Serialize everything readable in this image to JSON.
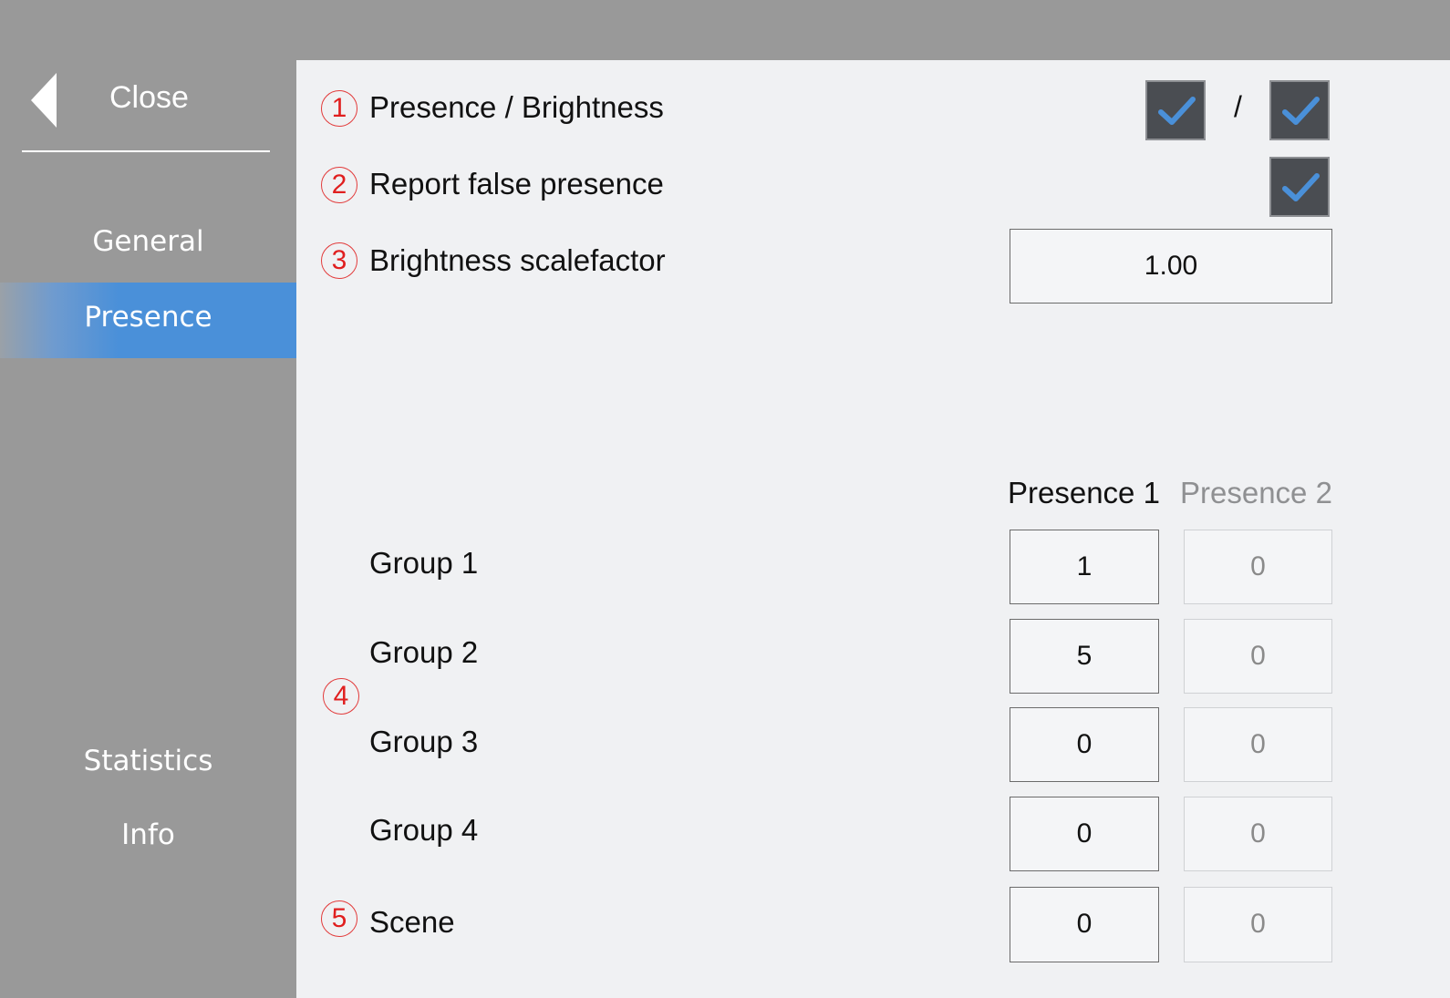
{
  "sidebar": {
    "close_label": "Close",
    "items": [
      {
        "label": "General"
      },
      {
        "label": "Presence",
        "active": true
      },
      {
        "label": "Statistics"
      },
      {
        "label": "Info"
      }
    ]
  },
  "settings": {
    "presence_brightness": {
      "number": "1",
      "label": "Presence / Brightness",
      "separator": "/",
      "presence_checked": true,
      "brightness_checked": true
    },
    "report_false_presence": {
      "number": "2",
      "label": "Report false presence",
      "checked": true
    },
    "brightness_scalefactor": {
      "number": "3",
      "label": "Brightness scalefactor",
      "value": "1.00"
    }
  },
  "groups": {
    "number": "4",
    "col_headers": [
      "Presence 1",
      "Presence 2"
    ],
    "rows": [
      {
        "label": "Group 1",
        "p1": "1",
        "p2": "0"
      },
      {
        "label": "Group 2",
        "p1": "5",
        "p2": "0"
      },
      {
        "label": "Group 3",
        "p1": "0",
        "p2": "0"
      },
      {
        "label": "Group 4",
        "p1": "0",
        "p2": "0"
      }
    ]
  },
  "scene": {
    "number": "5",
    "label": "Scene",
    "p1": "0",
    "p2": "0"
  },
  "colors": {
    "accent": "#4a90d9",
    "sidebar_bg": "#999999",
    "content_bg": "#f0f1f3",
    "annotation_red": "#e01f1f",
    "checkbox_bg": "#4a4d52"
  }
}
